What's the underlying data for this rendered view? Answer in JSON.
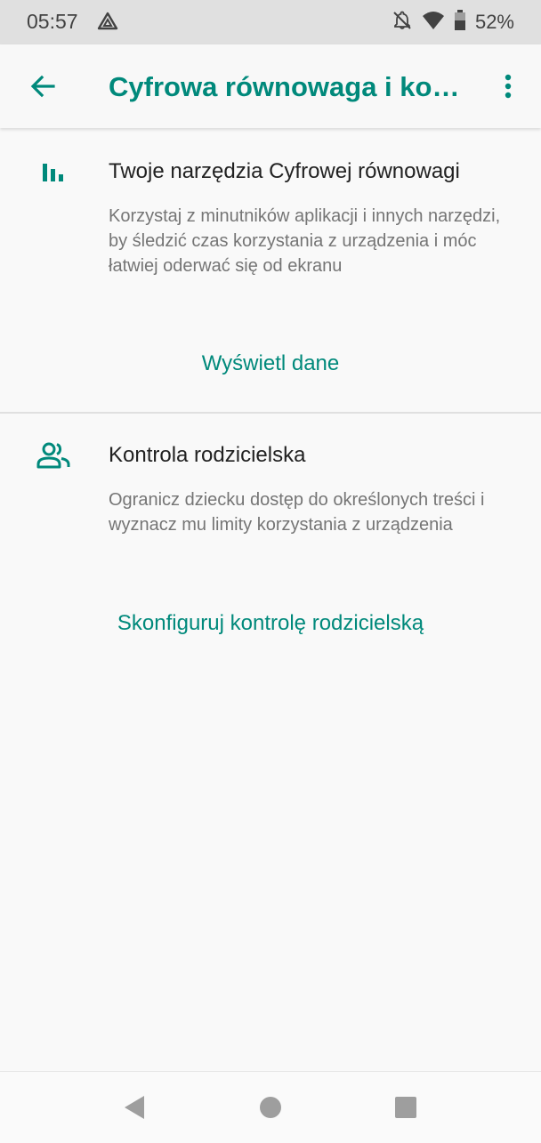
{
  "status_bar": {
    "time": "05:57",
    "battery_percent": "52%",
    "icons": [
      "app-notification-icon",
      "bell-off-icon",
      "wifi-icon",
      "battery-icon"
    ]
  },
  "app_bar": {
    "title": "Cyfrowa równowaga i kontrola rodzicielska",
    "icons": [
      "back-arrow-icon",
      "more-vert-icon"
    ]
  },
  "sections": [
    {
      "icon": "bar-chart-icon",
      "title": "Twoje narzędzia Cyfrowej równowagi",
      "description": "Korzystaj z minutników aplikacji i innych narzędzi, by śledzić czas korzystania z urządzenia i móc łatwiej oderwać się od ekranu",
      "action": "Wyświetl dane"
    },
    {
      "icon": "people-icon",
      "title": "Kontrola rodzicielska",
      "description": "Ogranicz dziecku dostęp do określonych treści i wyznacz mu limity korzystania z urządzenia",
      "action": "Skonfiguruj kontrolę rodzicielską"
    }
  ],
  "nav_bar": {
    "icons": [
      "back-triangle-icon",
      "home-circle-icon",
      "recents-square-icon"
    ]
  },
  "colors": {
    "accent": "#00897b",
    "status_bar_bg": "#e0e0e0",
    "background": "#f9f9f9",
    "secondary_text": "#757575"
  }
}
